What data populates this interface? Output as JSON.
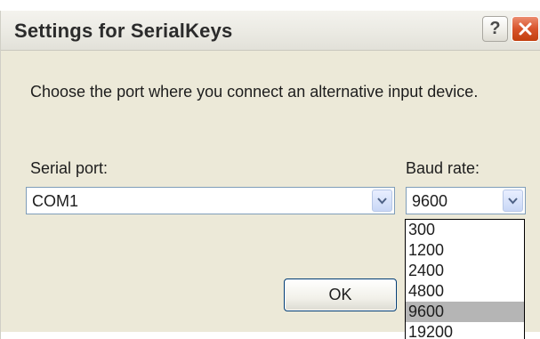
{
  "window": {
    "title": "Settings for SerialKeys",
    "help_label": "?"
  },
  "instruction": "Choose the port where you connect an alternative input device.",
  "serial_port": {
    "label": "Serial port:",
    "value": "COM1"
  },
  "baud_rate": {
    "label": "Baud rate:",
    "value": "9600",
    "options": [
      "300",
      "1200",
      "2400",
      "4800",
      "9600",
      "19200"
    ],
    "highlighted": "9600"
  },
  "ok_label": "OK",
  "colors": {
    "dialog_bg": "#ece9d8",
    "close_red": "#d8542b",
    "combo_border": "#7f9db9",
    "highlight": "#b5b5b5"
  },
  "icons": [
    "help-icon",
    "close-icon",
    "chevron-down-icon"
  ]
}
